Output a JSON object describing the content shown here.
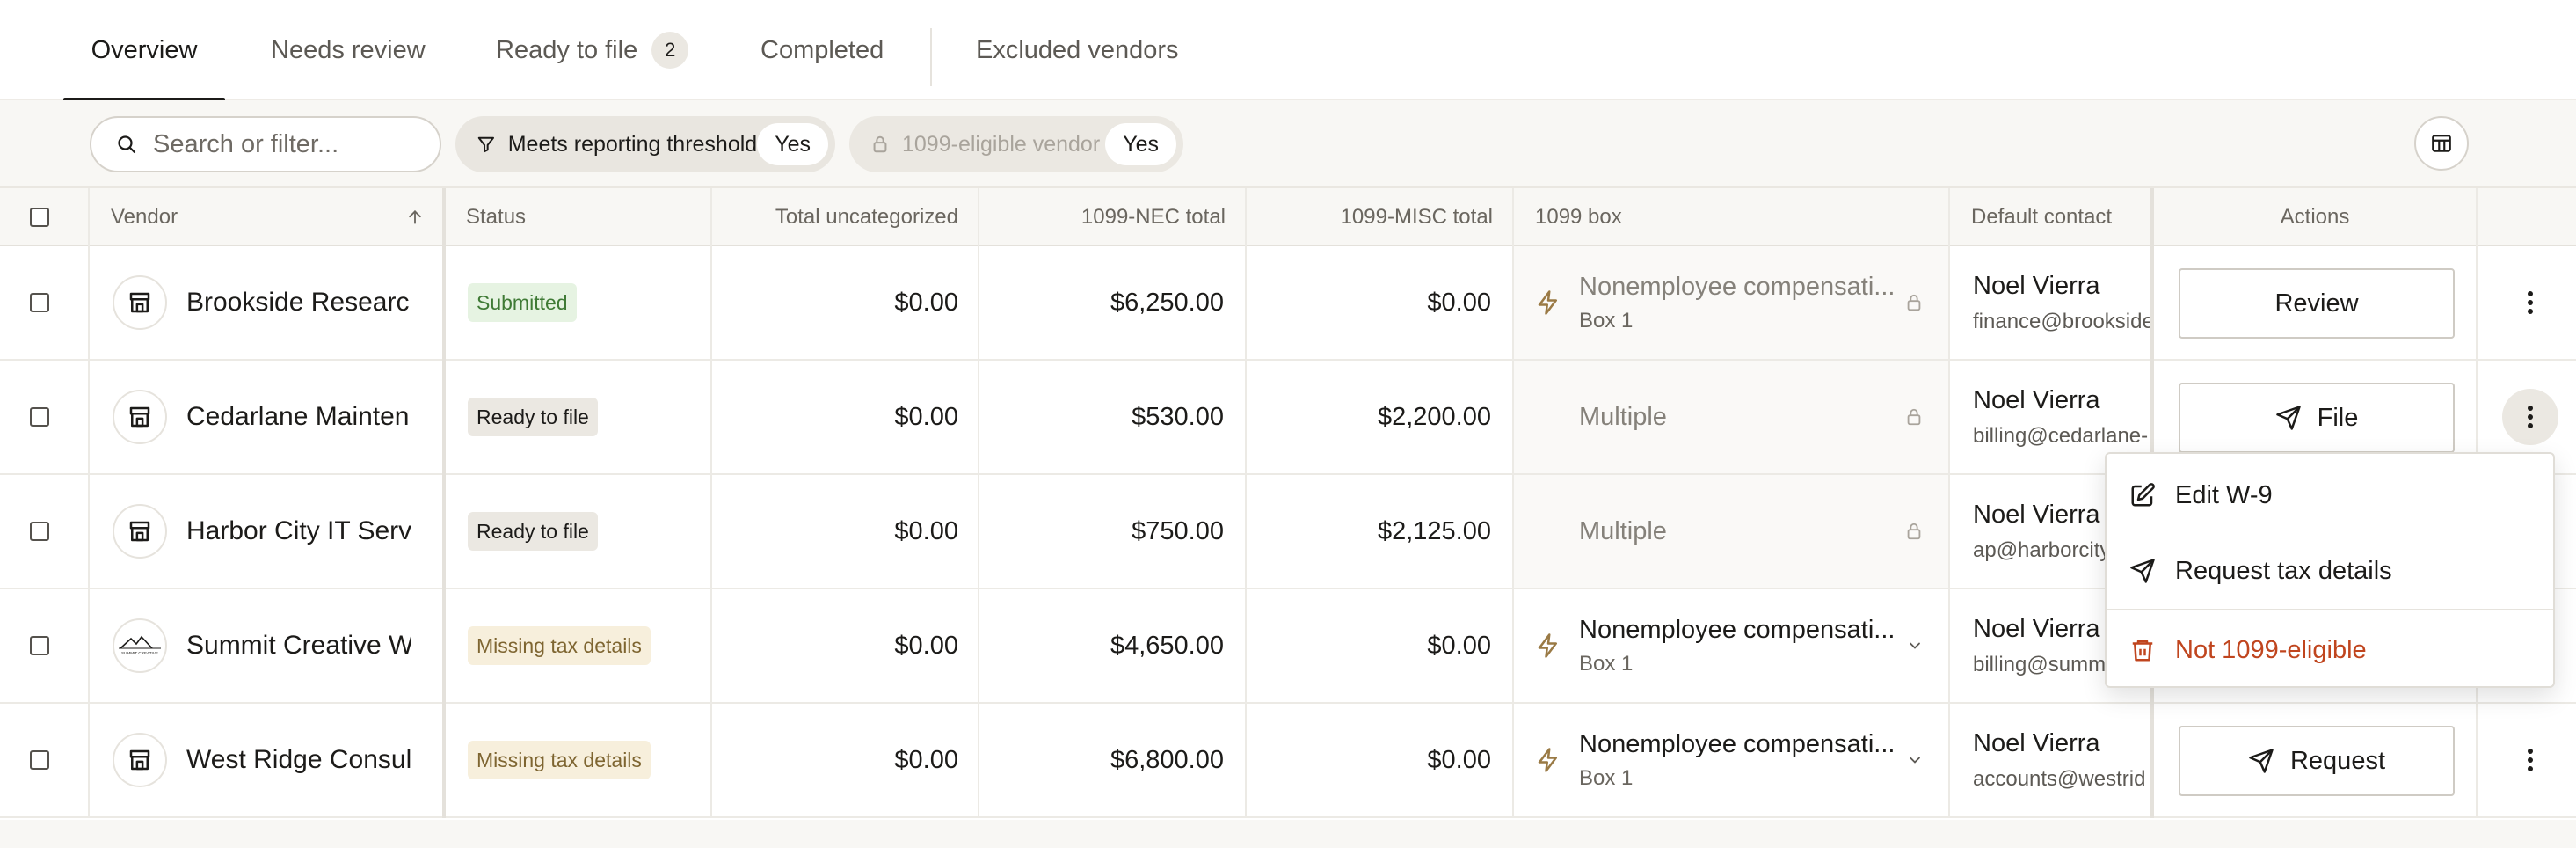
{
  "tabs": [
    {
      "label": "Overview",
      "active": true
    },
    {
      "label": "Needs review"
    },
    {
      "label": "Ready to file",
      "badge": "2"
    },
    {
      "label": "Completed"
    },
    {
      "label": "Excluded vendors"
    }
  ],
  "filters": {
    "search_placeholder": "Search or filter...",
    "threshold": {
      "label": "Meets reporting threshold",
      "value": "Yes"
    },
    "eligible": {
      "label": "1099-eligible vendor",
      "value": "Yes"
    }
  },
  "table": {
    "columns": {
      "vendor": "Vendor",
      "status": "Status",
      "uncategorized": "Total uncategorized",
      "nec": "1099-NEC total",
      "misc": "1099-MISC total",
      "box": "1099 box",
      "contact": "Default contact",
      "actions": "Actions"
    },
    "rows": [
      {
        "vendor": "Brookside Researc...",
        "status": "Submitted",
        "uncategorized": "$0.00",
        "nec": "$6,250.00",
        "misc": "$0.00",
        "box": "Nonemployee compensati...",
        "box_sub": "Box 1",
        "contact_name": "Noel Vierra",
        "contact_email": "finance@brookside",
        "action": "Review"
      },
      {
        "vendor": "Cedarlane Mainten...",
        "status": "Ready to file",
        "uncategorized": "$0.00",
        "nec": "$530.00",
        "misc": "$2,200.00",
        "box": "Multiple",
        "contact_name": "Noel Vierra",
        "contact_email": "billing@cedarlane-",
        "action": "File"
      },
      {
        "vendor": "Harbor City IT Servi...",
        "status": "Ready to file",
        "uncategorized": "$0.00",
        "nec": "$750.00",
        "misc": "$2,125.00",
        "box": "Multiple",
        "contact_name": "Noel Vierra",
        "contact_email": "ap@harborcity"
      },
      {
        "vendor": "Summit Creative W...",
        "status": "Missing tax details",
        "uncategorized": "$0.00",
        "nec": "$4,650.00",
        "misc": "$0.00",
        "box": "Nonemployee compensati...",
        "box_sub": "Box 1",
        "contact_name": "Noel Vierra",
        "contact_email": "billing@summ",
        "logo_text": "SUMMIT CREATIVE"
      },
      {
        "vendor": "West Ridge Consult...",
        "status": "Missing tax details",
        "uncategorized": "$0.00",
        "nec": "$6,800.00",
        "misc": "$0.00",
        "box": "Nonemployee compensati...",
        "box_sub": "Box 1",
        "contact_name": "Noel Vierra",
        "contact_email": "accounts@westrid",
        "action": "Request"
      }
    ]
  },
  "menu": {
    "items": [
      {
        "label": "Edit W-9",
        "icon": "edit-icon"
      },
      {
        "label": "Request tax details",
        "icon": "send-icon"
      },
      {
        "label": "Not 1099-eligible",
        "icon": "trash-icon",
        "danger": true
      }
    ]
  },
  "colors": {
    "accent_dark": "#1c1b19",
    "submitted_bg": "#e6f3e2",
    "submitted_fg": "#3f7a35",
    "missing_bg": "#f7efdc",
    "missing_fg": "#7e6531",
    "danger": "#c0451e",
    "bolt": "#9a7a45"
  }
}
